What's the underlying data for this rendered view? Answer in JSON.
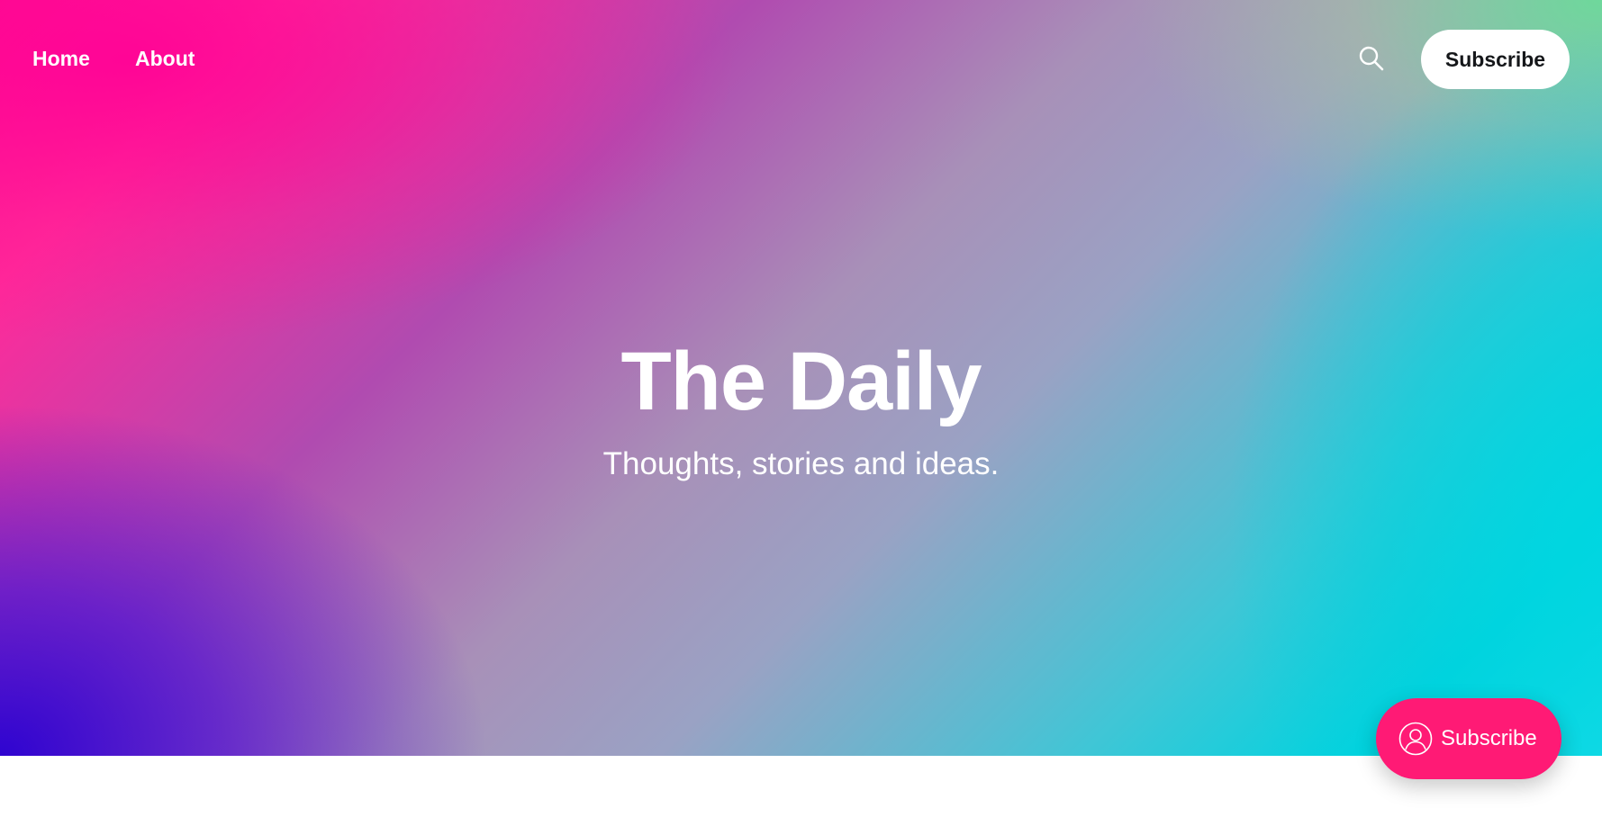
{
  "nav": {
    "links": [
      {
        "label": "Home"
      },
      {
        "label": "About"
      }
    ],
    "search_icon": "search-icon",
    "subscribe_label": "Subscribe"
  },
  "hero": {
    "title": "The Daily",
    "tagline": "Thoughts, stories and ideas.",
    "gradient_colors": [
      "#ff0a8f",
      "#2800d2",
      "#a890b8",
      "#6edc96",
      "#00d7e1"
    ]
  },
  "portal": {
    "icon": "user-circle-icon",
    "label": "Subscribe",
    "color": "#ff1a75"
  }
}
